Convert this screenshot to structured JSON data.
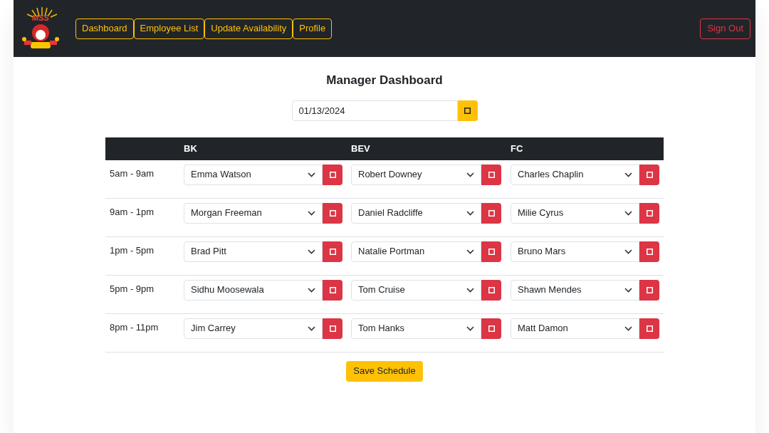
{
  "nav": {
    "logo_text": "MSS",
    "links": [
      {
        "label": "Dashboard"
      },
      {
        "label": "Employee List"
      },
      {
        "label": "Update Availability"
      },
      {
        "label": "Profile"
      }
    ],
    "sign_out": "Sign Out"
  },
  "title": "Manager Dashboard",
  "date_field": {
    "value": "01/13/2024"
  },
  "table": {
    "columns": [
      "BK",
      "BEV",
      "FC"
    ],
    "rows": [
      {
        "time": "5am - 9am",
        "cells": [
          "Emma Watson",
          "Robert Downey",
          "Charles Chaplin"
        ]
      },
      {
        "time": "9am - 1pm",
        "cells": [
          "Morgan Freeman",
          "Daniel Radcliffe",
          "Milie Cyrus"
        ]
      },
      {
        "time": "1pm - 5pm",
        "cells": [
          "Brad Pitt",
          "Natalie Portman",
          "Bruno Mars"
        ]
      },
      {
        "time": "5pm - 9pm",
        "cells": [
          "Sidhu Moosewala",
          "Tom Cruise",
          "Shawn Mendes"
        ]
      },
      {
        "time": "8pm - 11pm",
        "cells": [
          "Jim Carrey",
          "Tom Hanks",
          "Matt Damon"
        ]
      }
    ]
  },
  "save_button": "Save Schedule"
}
